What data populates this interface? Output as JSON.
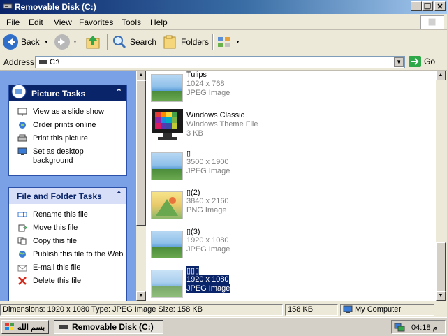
{
  "window": {
    "title": "Removable Disk (C:)",
    "controls": {
      "minimize": "_",
      "maximize": "❐",
      "close": "✕"
    }
  },
  "menu": [
    "File",
    "Edit",
    "View",
    "Favorites",
    "Tools",
    "Help"
  ],
  "toolbar": {
    "back_label": "Back",
    "search_label": "Search",
    "folders_label": "Folders"
  },
  "address": {
    "label": "Address",
    "path": "C:\\",
    "go_label": "Go"
  },
  "picture_tasks": {
    "title": "Picture Tasks",
    "items": [
      "View as a slide show",
      "Order prints online",
      "Print this picture",
      "Set as desktop background"
    ]
  },
  "file_tasks": {
    "title": "File and Folder Tasks",
    "items": [
      "Rename this file",
      "Move this file",
      "Copy this file",
      "Publish this file to the Web",
      "E-mail this file",
      "Delete this file"
    ]
  },
  "files": [
    {
      "name": "Tulips",
      "line1": "1024 x 768",
      "line2": "JPEG Image",
      "kind": "jpg",
      "selected": false
    },
    {
      "name": "Windows Classic",
      "line1": "Windows Theme File",
      "line2": "3 KB",
      "kind": "theme",
      "selected": false
    },
    {
      "name": "▯",
      "line1": "3500 x 1900",
      "line2": "JPEG Image",
      "kind": "jpg",
      "selected": false
    },
    {
      "name": "▯(2)",
      "line1": "3840 x 2160",
      "line2": "PNG Image",
      "kind": "png",
      "selected": false
    },
    {
      "name": "▯(3)",
      "line1": "1920 x 1080",
      "line2": "JPEG Image",
      "kind": "jpg",
      "selected": false
    },
    {
      "name": "▯▯▯",
      "line1": "1920 x 1080",
      "line2": "JPEG Image",
      "kind": "jpg",
      "selected": true
    }
  ],
  "status": {
    "details": "Dimensions: 1920 x 1080 Type: JPEG Image Size: 158 KB",
    "size": "158 KB",
    "zone": "My Computer"
  },
  "taskbar": {
    "start_label": "بسم الله",
    "window_button": "Removable Disk (C:)",
    "clock": "04:18 م"
  },
  "colors": {
    "title_bar": "#0a246a",
    "task_panel_border": "#2b52a8",
    "left_pane_bg": "#7aa1e6",
    "selection": "#0a246a"
  }
}
